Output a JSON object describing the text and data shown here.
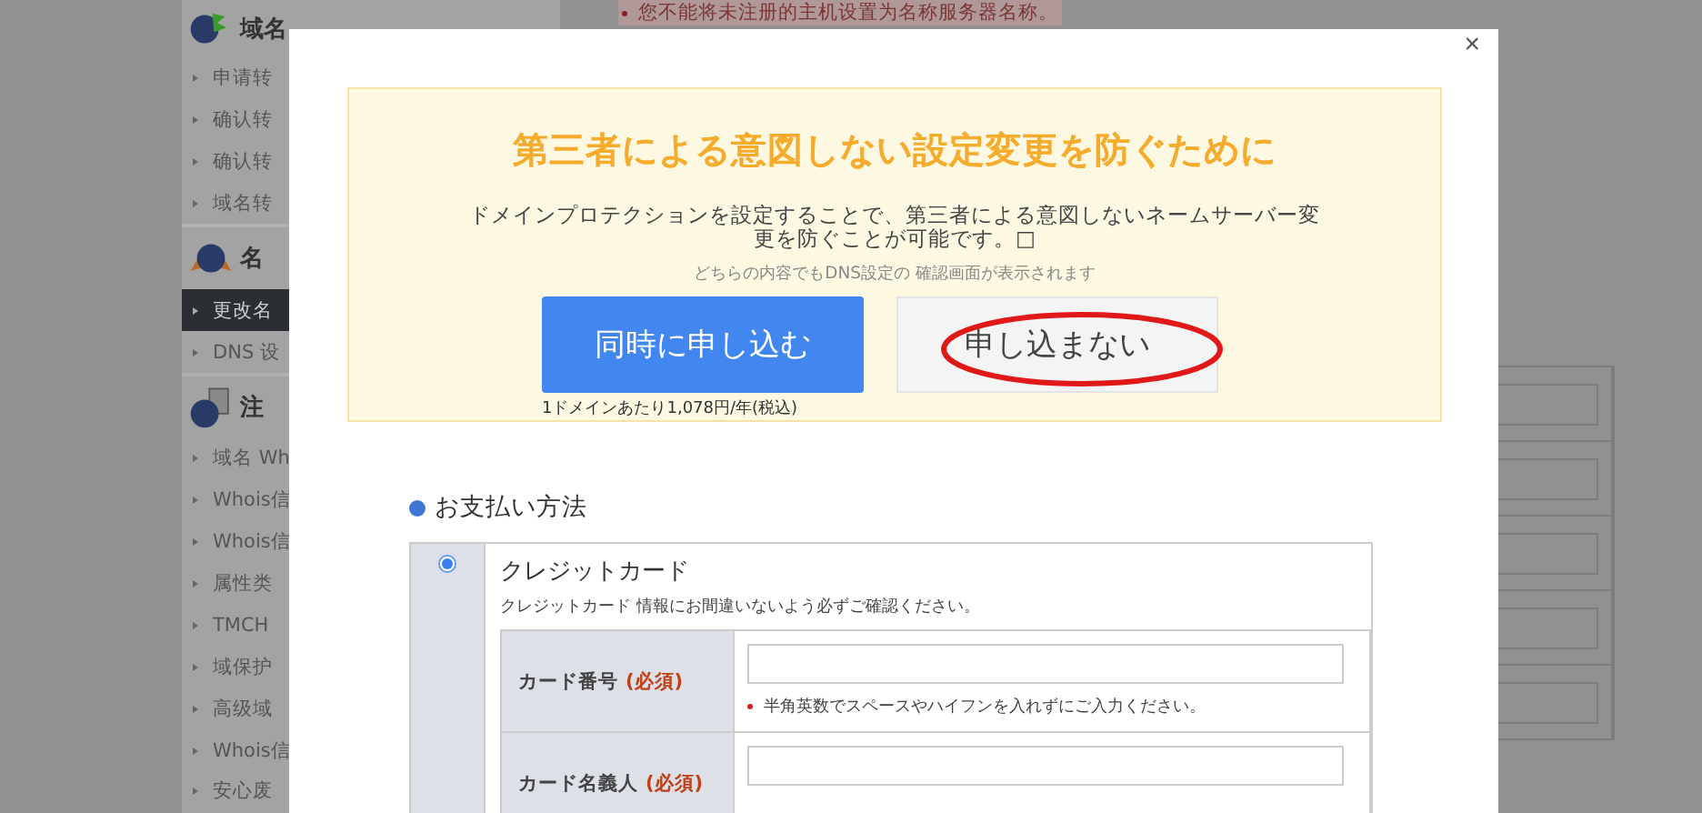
{
  "background_page": {
    "notice": "您不能将未注册的主机设置为名称服务器名称。",
    "sidebar": [
      {
        "title": "域名",
        "items": [
          {
            "label": "申请转",
            "selected": false
          },
          {
            "label": "确认转",
            "selected": false
          },
          {
            "label": "确认转",
            "selected": false
          },
          {
            "label": "域名转",
            "selected": false
          }
        ]
      },
      {
        "title": "名",
        "items": [
          {
            "label": "更改名",
            "selected": true
          },
          {
            "label": "DNS 设",
            "selected": false
          }
        ]
      },
      {
        "title": "注",
        "items": [
          {
            "label": "域名 Wh",
            "selected": false
          },
          {
            "label": "Whois信",
            "selected": false
          },
          {
            "label": "Whois信",
            "selected": false
          },
          {
            "label": "属性类",
            "selected": false
          },
          {
            "label": "TMCH",
            "selected": false
          },
          {
            "label": "域保护",
            "selected": false
          },
          {
            "label": "高级域",
            "selected": false
          },
          {
            "label": "Whois信",
            "selected": false
          },
          {
            "label": "安心废",
            "selected": false
          }
        ]
      }
    ]
  },
  "dialog": {
    "close": "×",
    "protection": {
      "title": "第三者による意図しない設定変更を防ぐために",
      "description": "ドメインプロテクションを設定することで、第三者による意図しないネームサーバー変更を防ぐことが可能です。□",
      "note": "どちらの内容でもDNS設定の 確認画面が表示されます",
      "buttons": [
        {
          "label": "同時に申し込む",
          "kind": "primary",
          "circled": false,
          "caption": "1ドメインあたり1,078円/年(税込)"
        },
        {
          "label": "申し込まない",
          "kind": "secondary",
          "circled": true
        }
      ]
    },
    "payment": {
      "heading": "お支払い方法",
      "methods": [
        {
          "selected": true,
          "title": "クレジットカード",
          "note": "クレジットカード 情報にお間違いないよう必ずご確認ください。",
          "fields": [
            {
              "label": "カード番号",
              "required": "(必須)",
              "hint": "半角英数でスペースやハイフンを入れずにご入力ください。"
            },
            {
              "label": "カード名義人",
              "required": "(必須)"
            }
          ]
        }
      ]
    }
  }
}
